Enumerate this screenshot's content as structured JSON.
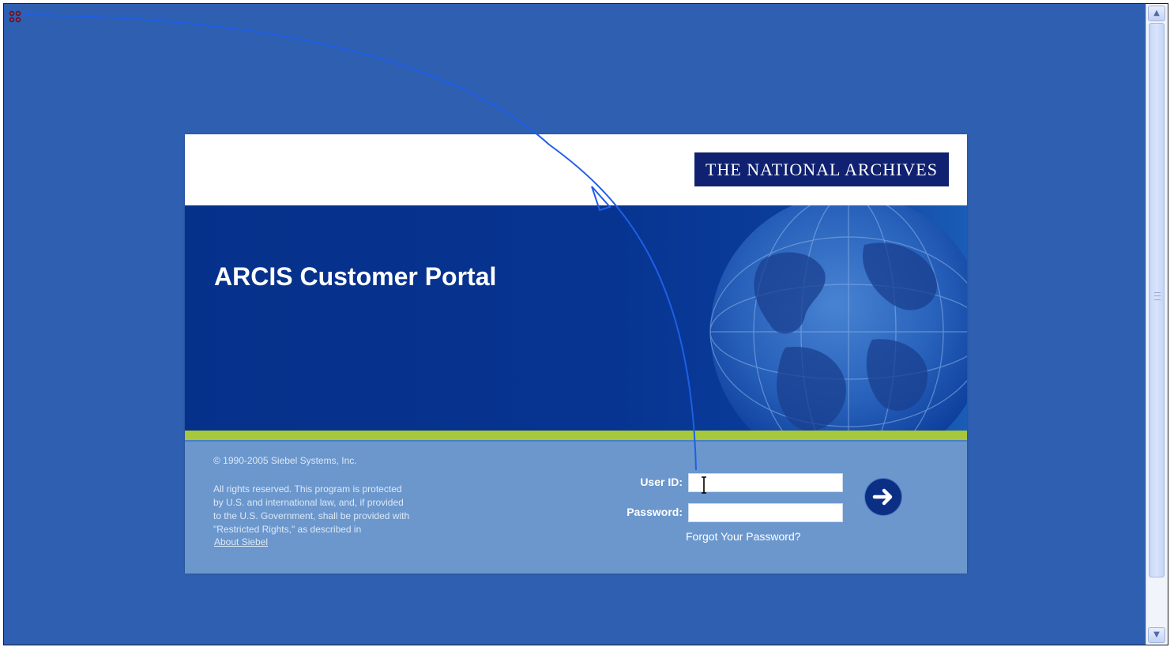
{
  "header": {
    "logo_text": "THE NATIONAL ARCHIVES"
  },
  "banner": {
    "title": "ARCIS Customer Portal"
  },
  "footer": {
    "copyright": "© 1990-2005 Siebel Systems, Inc.",
    "rights": " All rights reserved. This program is protected\nby U.S. and international law, and, if provided\nto the U.S. Government, shall be provided with\n\"Restricted Rights,\" as described in",
    "about_link": "About Siebel"
  },
  "login": {
    "user_id_label": "User ID:",
    "password_label": "Password:",
    "user_id_value": "",
    "password_value": "",
    "forgot_link": "Forgot Your Password?"
  },
  "icons": {
    "submit": "arrow-right-icon",
    "cursor": "text-cursor-icon",
    "handle": "drag-handle-icon",
    "scroll_up": "chevron-up-icon",
    "scroll_down": "chevron-down-icon"
  },
  "colors": {
    "page_bg": "#2f5fb0",
    "banner_bg": "#06318b",
    "logo_bg": "#0f2170",
    "accent_green": "#a6c83a",
    "footer_bg": "#6b97cd",
    "annotation_line": "#1f5ee6"
  }
}
